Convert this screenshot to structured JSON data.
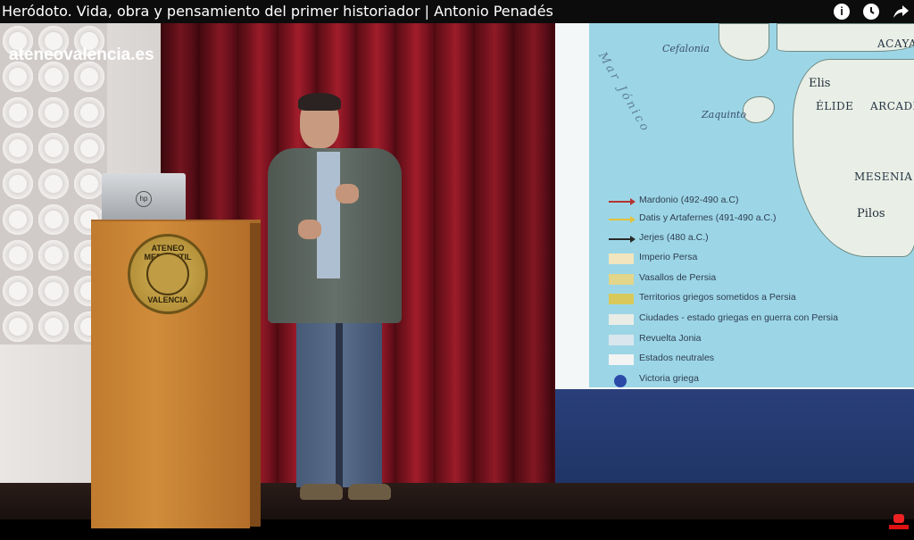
{
  "video": {
    "title": "Heródoto. Vida, obra y pensamiento del primer historiador | Antonio Penadés",
    "icons": [
      "info-icon",
      "clock-icon",
      "share-icon"
    ]
  },
  "watermark": "ateneovalencia.es",
  "podium": {
    "emblem_top": "ATENEO MERCANTIL",
    "emblem_bottom": "VALENCIA"
  },
  "map": {
    "sea_label": "Mar Jónico",
    "places": {
      "cefalonia": "Cefalonia",
      "acaya": "ACAYA",
      "elis": "Elis",
      "elide": "ÉLIDE",
      "arcadia": "ARCADI",
      "zaquinto": "Zaquinto",
      "mesenia": "MESENIA",
      "pilos": "Pilos"
    },
    "legend": [
      {
        "label": "Mardonio (492-490 a.C)",
        "kind": "arrow",
        "color": "#b4342f"
      },
      {
        "label": "Datis y Artafernes (491-490 a.C.)",
        "kind": "arrow",
        "color": "#e2c23a"
      },
      {
        "label": "Jerjes (480 a.C.)",
        "kind": "arrow",
        "color": "#2a2a2a"
      },
      {
        "label": "Imperio Persa",
        "kind": "swatch",
        "color": "#f1e6bd"
      },
      {
        "label": "Vasallos de Persia",
        "kind": "swatch",
        "color": "#e3d58a"
      },
      {
        "label": "Territorios griegos sometidos a Persia",
        "kind": "swatch",
        "color": "#d8c95a"
      },
      {
        "label": "Ciudades - estado griegas en guerra con Persia",
        "kind": "swatch",
        "color": "#e9ede6"
      },
      {
        "label": "Revuelta Jonia",
        "kind": "swatch",
        "color": "#d9e6ee"
      },
      {
        "label": "Estados neutrales",
        "kind": "swatch",
        "color": "#f2f4f4"
      },
      {
        "label": "Victoria griega",
        "kind": "marker",
        "color": "#2b4aa8"
      }
    ]
  }
}
